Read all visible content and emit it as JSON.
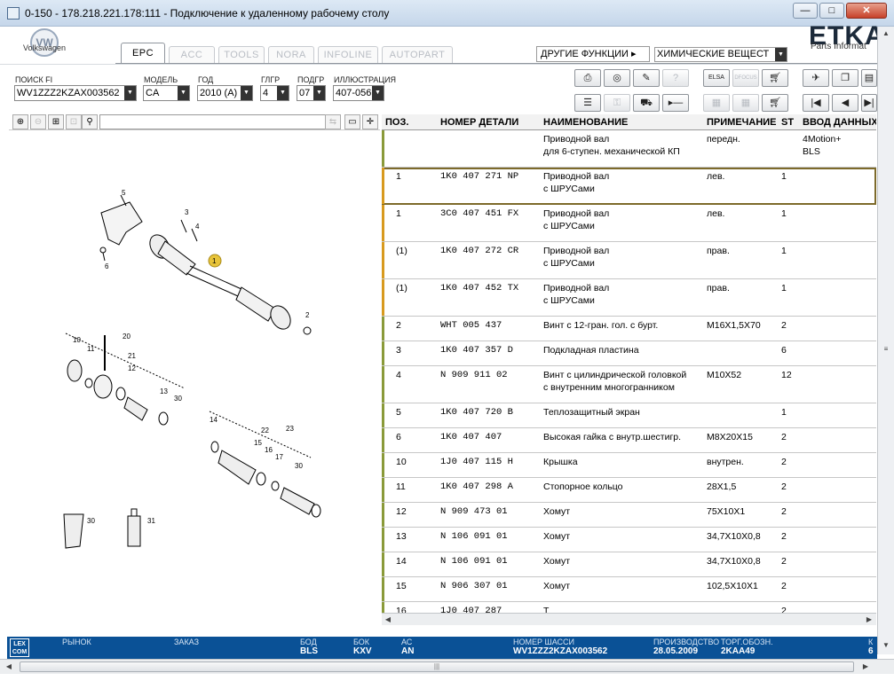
{
  "window": {
    "title": "0-150 - 178.218.221.178:111 - Подключение к удаленному рабочему столу",
    "minimize": "—",
    "maximize": "□",
    "close": "✕"
  },
  "header": {
    "vw_label": "Volkswagen",
    "tabs": [
      "EPC",
      "ACC",
      "TOOLS",
      "NORA",
      "INFOLINE",
      "AUTOPART"
    ],
    "other_functions": "ДРУГИЕ ФУНКЦИИ ▸",
    "chemicals": "ХИМИЧЕСКИЕ ВЕЩЕСТ",
    "etka_logo": "ETKA",
    "etka_sub": "Parts Informat"
  },
  "selection": {
    "search_fi": {
      "label": "ПОИСК FI",
      "value": "WV1ZZZ2KZAX003562"
    },
    "model": {
      "label": "МОДЕЛЬ",
      "value": "CA"
    },
    "year": {
      "label": "ГОД",
      "value": "2010 (A)"
    },
    "group": {
      "label": "ГЛГР",
      "value": "4"
    },
    "subgroup": {
      "label": "ПОДГР",
      "value": "07"
    },
    "illustration": {
      "label": "ИЛЛЮСТРАЦИЯ",
      "value": "407-056"
    }
  },
  "toolbar": {
    "row1": [
      "print-icon",
      "cd-icon",
      "camera-icon",
      "ssp-icon",
      "elsa-icon",
      "dfocus-icon",
      "cart-icon",
      "pin-icon",
      "copy-icon",
      "next-page-icon"
    ],
    "row2": [
      "list-icon",
      "key-icon",
      "car-icon",
      "arrow-right-icon",
      "elsa2-icon",
      "dfocus2-icon",
      "cart2-icon",
      "first-icon",
      "prev-icon",
      "last-icon"
    ],
    "labels": {
      "elsa": "ELSA",
      "dfocus": "DFOCUS"
    }
  },
  "table": {
    "columns": [
      "ПОЗ.",
      "НОМЕР ДЕТАЛИ",
      "НАИМЕНОВАНИЕ",
      "ПРИМЕЧАНИЕ",
      "ST",
      "ВВОД ДАННЫХ / МОДЕЛ"
    ],
    "rows": [
      {
        "pos": "",
        "part": "",
        "name": "Приводной вал",
        "name2": "для 6-ступен. механической КП",
        "note": "передн.",
        "st": "",
        "data": "4Motion+",
        "data2": "BLS",
        "bar": "#8a9a3a"
      },
      {
        "pos": "1",
        "part": "1K0  407  271  NP",
        "name": "Приводной вал",
        "name2": "с ШРУСами",
        "note": "лев.",
        "st": "1",
        "data": "",
        "data2": "",
        "bar": "#d89a1e"
      },
      {
        "pos": "1",
        "part": "3C0  407  451  FX",
        "name": "Приводной вал",
        "name2": "с ШРУСами",
        "note": "лев.",
        "st": "1",
        "data": "",
        "data2": "",
        "bar": "#d89a1e"
      },
      {
        "pos": "(1)",
        "part": "1K0  407  272  CR",
        "name": "Приводной вал",
        "name2": "с ШРУСами",
        "note": "прав.",
        "st": "1",
        "data": "",
        "data2": "",
        "bar": "#d89a1e"
      },
      {
        "pos": "(1)",
        "part": "1K0  407  452  TX",
        "name": "Приводной вал",
        "name2": "с ШРУСами",
        "note": "прав.",
        "st": "1",
        "data": "",
        "data2": "",
        "bar": "#d89a1e"
      },
      {
        "pos": "2",
        "part": "WHT  005  437",
        "name": "Винт с 12-гран. гол. с бурт.",
        "name2": "",
        "note": "M16X1,5X70",
        "st": "2",
        "data": "",
        "data2": "",
        "bar": "#8a9a3a"
      },
      {
        "pos": "3",
        "part": "1K0  407  357  D",
        "name": "Подкладная пластина",
        "name2": "",
        "note": "",
        "st": "6",
        "data": "",
        "data2": "",
        "bar": "#8a9a3a"
      },
      {
        "pos": "4",
        "part": "N    909  911  02",
        "name": "Винт с цилиндрической головкой",
        "name2": "с внутренним многогранником",
        "note": "M10X52",
        "st": "12",
        "data": "",
        "data2": "",
        "bar": "#8a9a3a"
      },
      {
        "pos": "5",
        "part": "1K0  407  720  B",
        "name": "Теплозащитный экран",
        "name2": "",
        "note": "",
        "st": "1",
        "data": "",
        "data2": "",
        "bar": "#8a9a3a"
      },
      {
        "pos": "6",
        "part": "1K0  407  407",
        "name": "Высокая гайка с внутр.шестигр.",
        "name2": "",
        "note": "M8X20X15",
        "st": "2",
        "data": "",
        "data2": "",
        "bar": "#8a9a3a"
      },
      {
        "pos": "10",
        "part": "1J0  407  115  H",
        "name": "Крышка",
        "name2": "",
        "note": "внутрен.",
        "st": "2",
        "data": "",
        "data2": "",
        "bar": "#8a9a3a"
      },
      {
        "pos": "11",
        "part": "1K0  407  298  A",
        "name": "Стопорное кольцо",
        "name2": "",
        "note": "28X1,5",
        "st": "2",
        "data": "",
        "data2": "",
        "bar": "#8a9a3a"
      },
      {
        "pos": "12",
        "part": "N    909  473  01",
        "name": "Хомут",
        "name2": "",
        "note": "75X10X1",
        "st": "2",
        "data": "",
        "data2": "",
        "bar": "#8a9a3a"
      },
      {
        "pos": "13",
        "part": "N    106  091  01",
        "name": "Хомут",
        "name2": "",
        "note": "34,7X10X0,8",
        "st": "2",
        "data": "",
        "data2": "",
        "bar": "#8a9a3a"
      },
      {
        "pos": "14",
        "part": "N    106  091  01",
        "name": "Хомут",
        "name2": "",
        "note": "34,7X10X0,8",
        "st": "2",
        "data": "",
        "data2": "",
        "bar": "#8a9a3a"
      },
      {
        "pos": "15",
        "part": "N    906  307  01",
        "name": "Хомут",
        "name2": "",
        "note": "102,5X10X1",
        "st": "2",
        "data": "",
        "data2": "",
        "bar": "#8a9a3a"
      },
      {
        "pos": "16",
        "part": "1J0  407  287",
        "name": "Т",
        "name2": "",
        "note": "",
        "st": "2",
        "data": "",
        "data2": "",
        "bar": "#8a9a3a"
      }
    ]
  },
  "illustration": {
    "callouts": [
      "1",
      "2",
      "3",
      "4",
      "5",
      "6",
      "10",
      "11",
      "12",
      "13",
      "30",
      "20",
      "21",
      "14",
      "15",
      "16",
      "17",
      "30",
      "22",
      "23",
      "30",
      "31"
    ]
  },
  "status": {
    "lexcom": "LEX\nCOM",
    "fields": [
      {
        "label": "РЫНОК",
        "value": ""
      },
      {
        "label": "ЗАКАЗ",
        "value": ""
      },
      {
        "label": "БОД",
        "value": "BLS"
      },
      {
        "label": "БОК",
        "value": "KXV"
      },
      {
        "label": "АС",
        "value": "AN"
      },
      {
        "label": "НОМЕР ШАССИ",
        "value": "WV1ZZZ2KZAX003562"
      },
      {
        "label": "ПРОИЗВОДСТВО",
        "value": "28.05.2009"
      },
      {
        "label": "ТОРГ.ОБОЗН.",
        "value": "2KAA49"
      },
      {
        "label": "К",
        "value": "6"
      }
    ]
  }
}
